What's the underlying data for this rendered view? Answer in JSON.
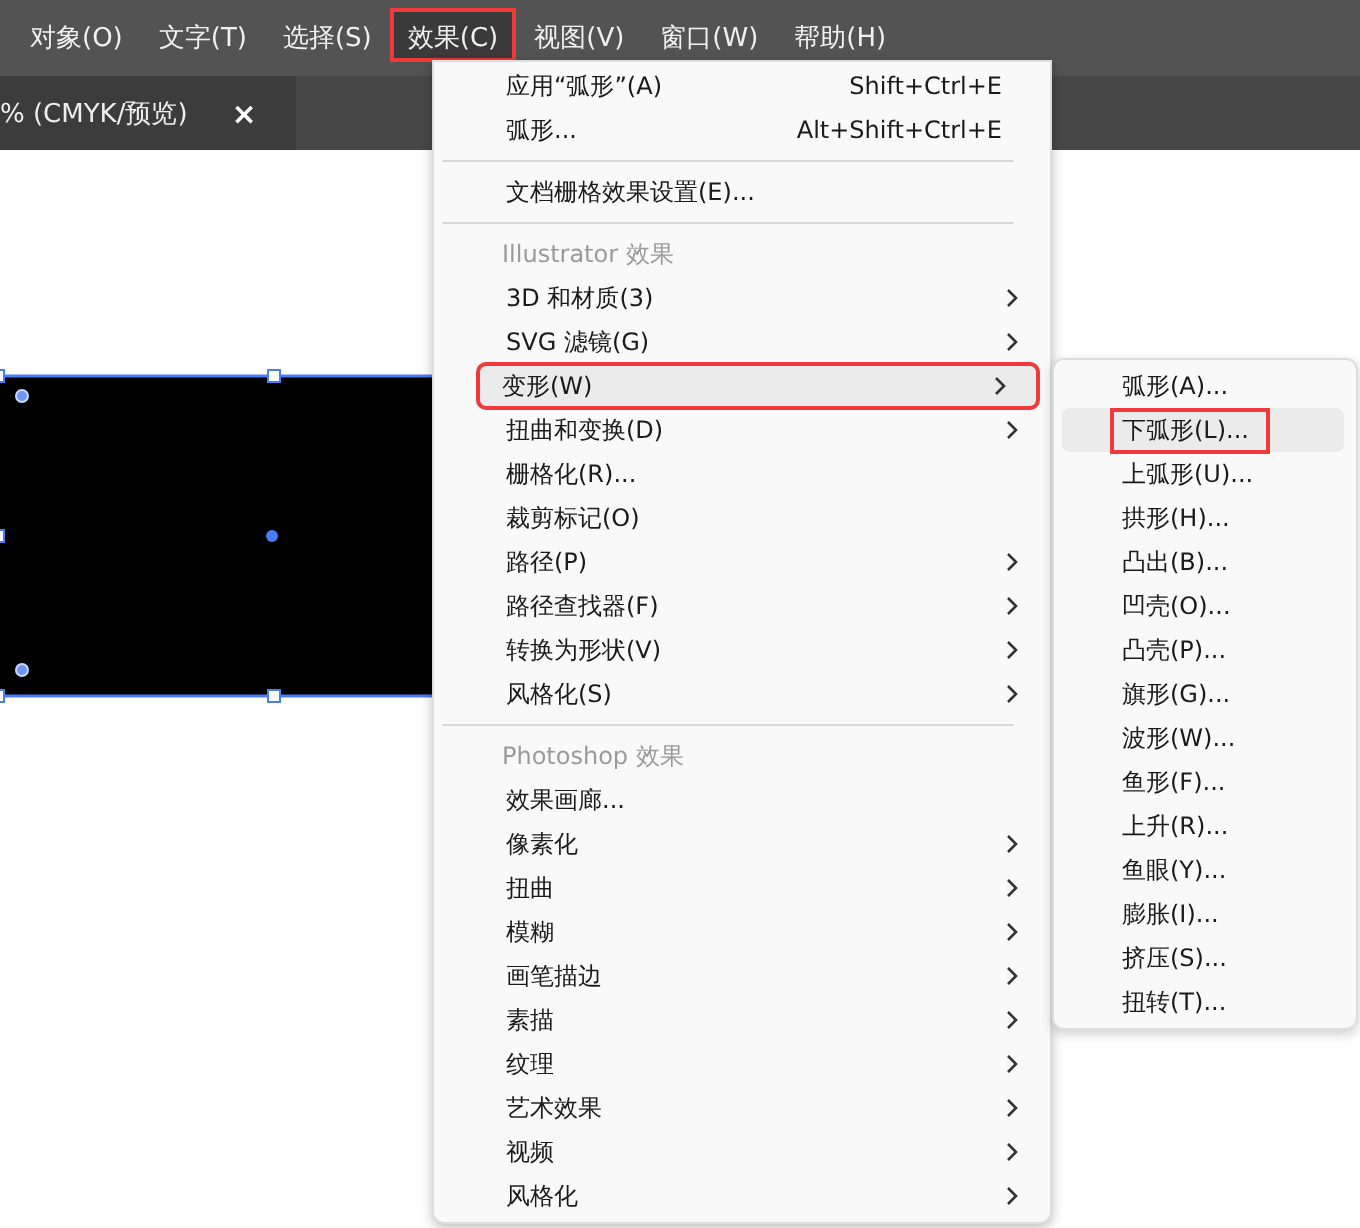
{
  "menubar": [
    {
      "label": "对象(O)",
      "selected": false,
      "highlighted": false
    },
    {
      "label": "文字(T)",
      "selected": false,
      "highlighted": false
    },
    {
      "label": "选择(S)",
      "selected": false,
      "highlighted": false
    },
    {
      "label": "效果(C)",
      "selected": true,
      "highlighted": true
    },
    {
      "label": "视图(V)",
      "selected": false,
      "highlighted": false
    },
    {
      "label": "窗口(W)",
      "selected": false,
      "highlighted": false
    },
    {
      "label": "帮助(H)",
      "selected": false,
      "highlighted": false
    }
  ],
  "document_tab": {
    "title": "% (CMYK/预览)",
    "close": "×"
  },
  "effect_menu": [
    {
      "kind": "item",
      "label": "应用“弧形”(A)",
      "shortcut": "Shift+Ctrl+E",
      "has_submenu": false,
      "selected": false,
      "highlighted": false
    },
    {
      "kind": "item",
      "label": "弧形...",
      "shortcut": "Alt+Shift+Ctrl+E",
      "has_submenu": false,
      "selected": false,
      "highlighted": false
    },
    {
      "kind": "separator"
    },
    {
      "kind": "item",
      "label": "文档栅格效果设置(E)...",
      "has_submenu": false,
      "selected": false,
      "highlighted": false
    },
    {
      "kind": "separator"
    },
    {
      "kind": "header",
      "label": "Illustrator 效果"
    },
    {
      "kind": "item",
      "label": "3D 和材质(3)",
      "has_submenu": true,
      "selected": false,
      "highlighted": false
    },
    {
      "kind": "item",
      "label": "SVG 滤镜(G)",
      "has_submenu": true,
      "selected": false,
      "highlighted": false
    },
    {
      "kind": "item",
      "label": "变形(W)",
      "has_submenu": true,
      "selected": true,
      "highlighted": true
    },
    {
      "kind": "item",
      "label": "扭曲和变换(D)",
      "has_submenu": true,
      "selected": false,
      "highlighted": false
    },
    {
      "kind": "item",
      "label": "栅格化(R)...",
      "has_submenu": false,
      "selected": false,
      "highlighted": false
    },
    {
      "kind": "item",
      "label": "裁剪标记(O)",
      "has_submenu": false,
      "selected": false,
      "highlighted": false
    },
    {
      "kind": "item",
      "label": "路径(P)",
      "has_submenu": true,
      "selected": false,
      "highlighted": false
    },
    {
      "kind": "item",
      "label": "路径查找器(F)",
      "has_submenu": true,
      "selected": false,
      "highlighted": false
    },
    {
      "kind": "item",
      "label": "转换为形状(V)",
      "has_submenu": true,
      "selected": false,
      "highlighted": false
    },
    {
      "kind": "item",
      "label": "风格化(S)",
      "has_submenu": true,
      "selected": false,
      "highlighted": false
    },
    {
      "kind": "separator"
    },
    {
      "kind": "header",
      "label": "Photoshop 效果"
    },
    {
      "kind": "item",
      "label": "效果画廊...",
      "has_submenu": false,
      "selected": false,
      "highlighted": false
    },
    {
      "kind": "item",
      "label": "像素化",
      "has_submenu": true,
      "selected": false,
      "highlighted": false
    },
    {
      "kind": "item",
      "label": "扭曲",
      "has_submenu": true,
      "selected": false,
      "highlighted": false
    },
    {
      "kind": "item",
      "label": "模糊",
      "has_submenu": true,
      "selected": false,
      "highlighted": false
    },
    {
      "kind": "item",
      "label": "画笔描边",
      "has_submenu": true,
      "selected": false,
      "highlighted": false
    },
    {
      "kind": "item",
      "label": "素描",
      "has_submenu": true,
      "selected": false,
      "highlighted": false
    },
    {
      "kind": "item",
      "label": "纹理",
      "has_submenu": true,
      "selected": false,
      "highlighted": false
    },
    {
      "kind": "item",
      "label": "艺术效果",
      "has_submenu": true,
      "selected": false,
      "highlighted": false
    },
    {
      "kind": "item",
      "label": "视频",
      "has_submenu": true,
      "selected": false,
      "highlighted": false
    },
    {
      "kind": "item",
      "label": "风格化",
      "has_submenu": true,
      "selected": false,
      "highlighted": false
    }
  ],
  "warp_submenu": [
    {
      "label": "弧形(A)...",
      "selected": false,
      "highlighted": false
    },
    {
      "label": "下弧形(L)...",
      "selected": true,
      "highlighted": true
    },
    {
      "label": "上弧形(U)...",
      "selected": false,
      "highlighted": false
    },
    {
      "label": "拱形(H)...",
      "selected": false,
      "highlighted": false
    },
    {
      "label": "凸出(B)...",
      "selected": false,
      "highlighted": false
    },
    {
      "label": "凹壳(O)...",
      "selected": false,
      "highlighted": false
    },
    {
      "label": "凸壳(P)...",
      "selected": false,
      "highlighted": false
    },
    {
      "label": "旗形(G)...",
      "selected": false,
      "highlighted": false
    },
    {
      "label": "波形(W)...",
      "selected": false,
      "highlighted": false
    },
    {
      "label": "鱼形(F)...",
      "selected": false,
      "highlighted": false
    },
    {
      "label": "上升(R)...",
      "selected": false,
      "highlighted": false
    },
    {
      "label": "鱼眼(Y)...",
      "selected": false,
      "highlighted": false
    },
    {
      "label": "膨胀(I)...",
      "selected": false,
      "highlighted": false
    },
    {
      "label": "挤压(S)...",
      "selected": false,
      "highlighted": false
    },
    {
      "label": "扭转(T)...",
      "selected": false,
      "highlighted": false
    }
  ]
}
